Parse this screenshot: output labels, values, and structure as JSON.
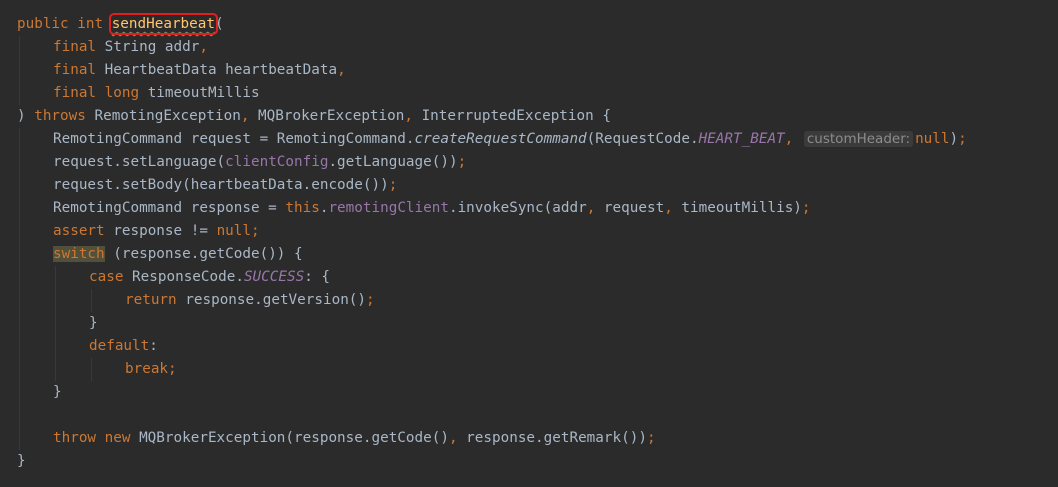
{
  "editor": {
    "lines": [
      {
        "indent": 0,
        "tokens": [
          {
            "t": "public int ",
            "c": "kw"
          },
          {
            "t": "sendHearbeat",
            "c": "fn squiggle sel-box",
            "name": "method-name-highlight"
          },
          {
            "t": "(",
            "c": ""
          }
        ]
      },
      {
        "indent": 1,
        "tokens": [
          {
            "t": "final ",
            "c": "kw"
          },
          {
            "t": "String addr",
            "c": ""
          },
          {
            "t": ",",
            "c": "kw"
          }
        ]
      },
      {
        "indent": 1,
        "tokens": [
          {
            "t": "final ",
            "c": "kw"
          },
          {
            "t": "HeartbeatData heartbeatData",
            "c": ""
          },
          {
            "t": ",",
            "c": "kw"
          }
        ]
      },
      {
        "indent": 1,
        "tokens": [
          {
            "t": "final long ",
            "c": "kw"
          },
          {
            "t": "timeoutMillis",
            "c": ""
          }
        ]
      },
      {
        "indent": 0,
        "tokens": [
          {
            "t": ") ",
            "c": ""
          },
          {
            "t": "throws ",
            "c": "kw"
          },
          {
            "t": "RemotingException",
            "c": ""
          },
          {
            "t": ", ",
            "c": "kw"
          },
          {
            "t": "MQBrokerException",
            "c": ""
          },
          {
            "t": ", ",
            "c": "kw"
          },
          {
            "t": "InterruptedException {",
            "c": ""
          }
        ]
      },
      {
        "indent": 1,
        "tokens": [
          {
            "t": "RemotingCommand request = RemotingCommand.",
            "c": ""
          },
          {
            "t": "createRequestCommand",
            "c": "ital"
          },
          {
            "t": "(RequestCode.",
            "c": ""
          },
          {
            "t": "HEART_BEAT",
            "c": "cst"
          },
          {
            "t": ", ",
            "c": "kw"
          },
          {
            "t": "customHeader:",
            "c": "hint",
            "name": "parameter-hint"
          },
          {
            "t": "null",
            "c": "kw"
          },
          {
            "t": ")",
            "c": ""
          },
          {
            "t": ";",
            "c": "kw"
          }
        ]
      },
      {
        "indent": 1,
        "tokens": [
          {
            "t": "request.setLanguage(",
            "c": ""
          },
          {
            "t": "clientConfig",
            "c": "fld"
          },
          {
            "t": ".getLanguage())",
            "c": ""
          },
          {
            "t": ";",
            "c": "kw"
          }
        ]
      },
      {
        "indent": 1,
        "tokens": [
          {
            "t": "request.setBody(heartbeatData.encode())",
            "c": ""
          },
          {
            "t": ";",
            "c": "kw"
          }
        ]
      },
      {
        "indent": 1,
        "tokens": [
          {
            "t": "RemotingCommand response = ",
            "c": ""
          },
          {
            "t": "this",
            "c": "kw"
          },
          {
            "t": ".",
            "c": ""
          },
          {
            "t": "remotingClient",
            "c": "fld"
          },
          {
            "t": ".invokeSync(addr",
            "c": ""
          },
          {
            "t": ", ",
            "c": "kw"
          },
          {
            "t": "request",
            "c": ""
          },
          {
            "t": ", ",
            "c": "kw"
          },
          {
            "t": "timeoutMillis)",
            "c": ""
          },
          {
            "t": ";",
            "c": "kw"
          }
        ]
      },
      {
        "indent": 1,
        "tokens": [
          {
            "t": "assert ",
            "c": "kw"
          },
          {
            "t": "response != ",
            "c": ""
          },
          {
            "t": "null",
            "c": "kw"
          },
          {
            "t": ";",
            "c": "kw"
          }
        ]
      },
      {
        "indent": 1,
        "tokens": [
          {
            "t": "switch",
            "c": "kw hl-bg"
          },
          {
            "t": " (response.getCode()) {",
            "c": ""
          }
        ]
      },
      {
        "indent": 2,
        "tokens": [
          {
            "t": "case ",
            "c": "kw"
          },
          {
            "t": "ResponseCode.",
            "c": ""
          },
          {
            "t": "SUCCESS",
            "c": "cst"
          },
          {
            "t": ": {",
            "c": ""
          }
        ]
      },
      {
        "indent": 3,
        "tokens": [
          {
            "t": "return ",
            "c": "kw"
          },
          {
            "t": "response.getVersion()",
            "c": ""
          },
          {
            "t": ";",
            "c": "kw"
          }
        ]
      },
      {
        "indent": 2,
        "tokens": [
          {
            "t": "}",
            "c": ""
          }
        ]
      },
      {
        "indent": 2,
        "tokens": [
          {
            "t": "default",
            "c": "kw"
          },
          {
            "t": ":",
            "c": ""
          }
        ]
      },
      {
        "indent": 3,
        "tokens": [
          {
            "t": "break;",
            "c": "kw"
          }
        ]
      },
      {
        "indent": 1,
        "tokens": [
          {
            "t": "}",
            "c": ""
          }
        ]
      },
      {
        "indent": 0,
        "tokens": []
      },
      {
        "indent": 1,
        "tokens": [
          {
            "t": "throw new ",
            "c": "kw"
          },
          {
            "t": "MQBrokerException(response.getCode()",
            "c": ""
          },
          {
            "t": ", ",
            "c": "kw"
          },
          {
            "t": "response.getRemark())",
            "c": ""
          },
          {
            "t": ";",
            "c": "kw"
          }
        ]
      },
      {
        "indent": 0,
        "tokens": [
          {
            "t": "}",
            "c": ""
          }
        ]
      }
    ]
  }
}
